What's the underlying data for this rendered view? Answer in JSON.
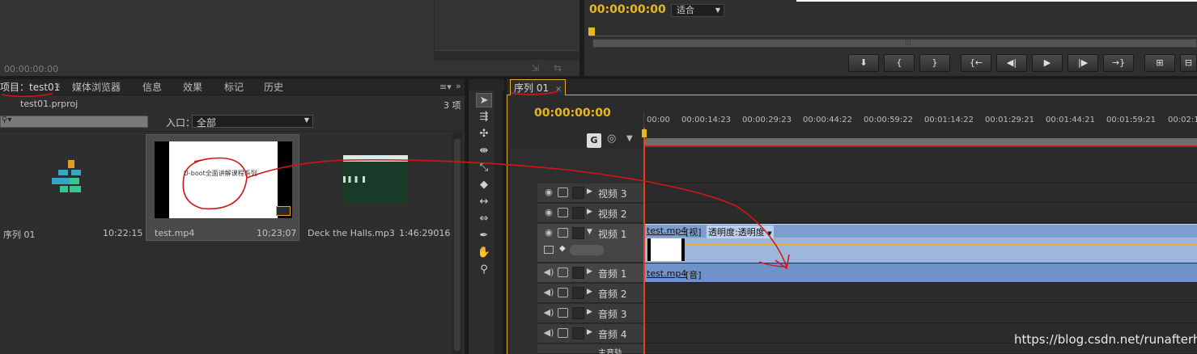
{
  "source_monitor": {
    "timecode": "00:00:00:00"
  },
  "program_monitor": {
    "timecode": "00:00:00:00",
    "zoom_select": "适合",
    "transport_buttons": [
      "mark-in",
      "in-brace",
      "out-brace",
      "go-in",
      "step-back",
      "play",
      "step-forward",
      "go-out",
      "lift",
      "extract"
    ]
  },
  "project_panel": {
    "tabs": [
      "项目：test01",
      "媒体浏览器",
      "信息",
      "效果",
      "标记",
      "历史"
    ],
    "project_file": "test01.prproj",
    "item_count": "3 项",
    "in_label": "入口：",
    "in_value": "全部",
    "items": [
      {
        "name": "序列 01",
        "duration": "10:22:15"
      },
      {
        "name": "test.mp4",
        "duration": "10;23;07",
        "thumb_title": "U-boot全面讲解课程系列"
      },
      {
        "name": "Deck the Halls.mp3",
        "duration": "1:46:29016"
      }
    ]
  },
  "timeline": {
    "tab": "序列 01",
    "timecode": "00:00:00:00",
    "ruler": [
      "00:00",
      "00:00:14:23",
      "00:00:29:23",
      "00:00:44:22",
      "00:00:59:22",
      "00:01:14:22",
      "00:01:29:21",
      "00:01:44:21",
      "00:01:59:21",
      "00:02:1"
    ],
    "tracks": [
      {
        "name": "视频 3",
        "type": "video"
      },
      {
        "name": "视频 2",
        "type": "video"
      },
      {
        "name": "视频 1",
        "type": "video"
      },
      {
        "name": "音频 1",
        "type": "audio"
      },
      {
        "name": "音频 2",
        "type": "audio"
      },
      {
        "name": "音频 3",
        "type": "audio"
      },
      {
        "name": "音频 4",
        "type": "audio"
      },
      {
        "name": "主音轨",
        "type": "master"
      }
    ],
    "video_clip": {
      "name": "test.mp4",
      "tag": "[视]",
      "effect": "透明度:透明度"
    },
    "audio_clip": {
      "name": "test.mp4",
      "tag": "[音]"
    }
  },
  "watermark": "https://blog.csdn.net/runafterhit",
  "colors": {
    "accent": "#e8b71c",
    "clip_video": "#8aa9d4",
    "clip_audio": "#6f93c9",
    "annotation": "#d01818"
  }
}
